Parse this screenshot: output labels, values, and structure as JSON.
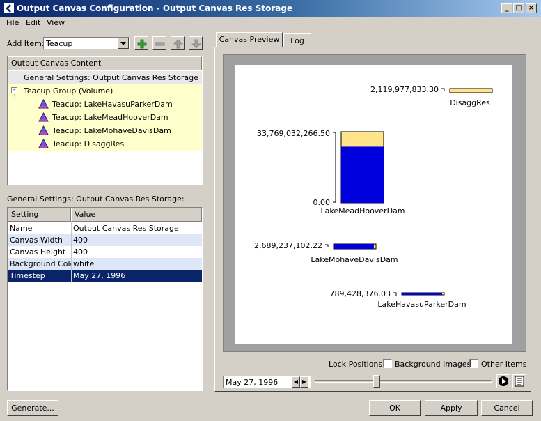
{
  "window": {
    "title": "Output Canvas Configuration - Output Canvas Res Storage"
  },
  "menu": [
    "File",
    "Edit",
    "View"
  ],
  "add_item": {
    "label": "Add Item:",
    "value": "Teacup"
  },
  "tree": {
    "header": "Output Canvas Content",
    "items": [
      "General Settings: Output Canvas Res Storage",
      "Teacup Group (Volume)",
      "Teacup: LakeHavasuParkerDam",
      "Teacup: LakeMeadHooverDam",
      "Teacup: LakeMohaveDavisDam",
      "Teacup: DisaggRes"
    ]
  },
  "settings": {
    "section_label": "General Settings: Output Canvas Res Storage:",
    "columns": [
      "Setting",
      "Value"
    ],
    "rows": [
      [
        "Name",
        "Output Canvas Res Storage"
      ],
      [
        "Canvas Width",
        "400"
      ],
      [
        "Canvas Height",
        "400"
      ],
      [
        "Background Color",
        "white"
      ],
      [
        "Timestep",
        "May 27, 1996"
      ]
    ]
  },
  "tabs": [
    "Canvas Preview",
    "Log"
  ],
  "canvas": {
    "teacups": [
      {
        "name": "DisaggRes",
        "capacity": "2,119,977,833.30",
        "fill": 0.0
      },
      {
        "name": "LakeMeadHooverDam",
        "capacity": "33,769,032,266.50",
        "zero": "0.00",
        "fill": 0.79
      },
      {
        "name": "LakeMohaveDavisDam",
        "capacity": "2,689,237,102.22",
        "fill": 0.95
      },
      {
        "name": "LakeHavasuParkerDam",
        "capacity": "789,428,376.03",
        "fill": 0.95
      }
    ],
    "colors": {
      "water": "#0000dd",
      "empty": "#ffe48a"
    }
  },
  "lock": {
    "label": "Lock Positions:",
    "background_images": "Background Images",
    "other_items": "Other Items"
  },
  "timestep": {
    "value": "May 27, 1996",
    "slider_fraction": 0.35
  },
  "buttons": {
    "generate": "Generate...",
    "ok": "OK",
    "apply": "Apply",
    "cancel": "Cancel"
  }
}
